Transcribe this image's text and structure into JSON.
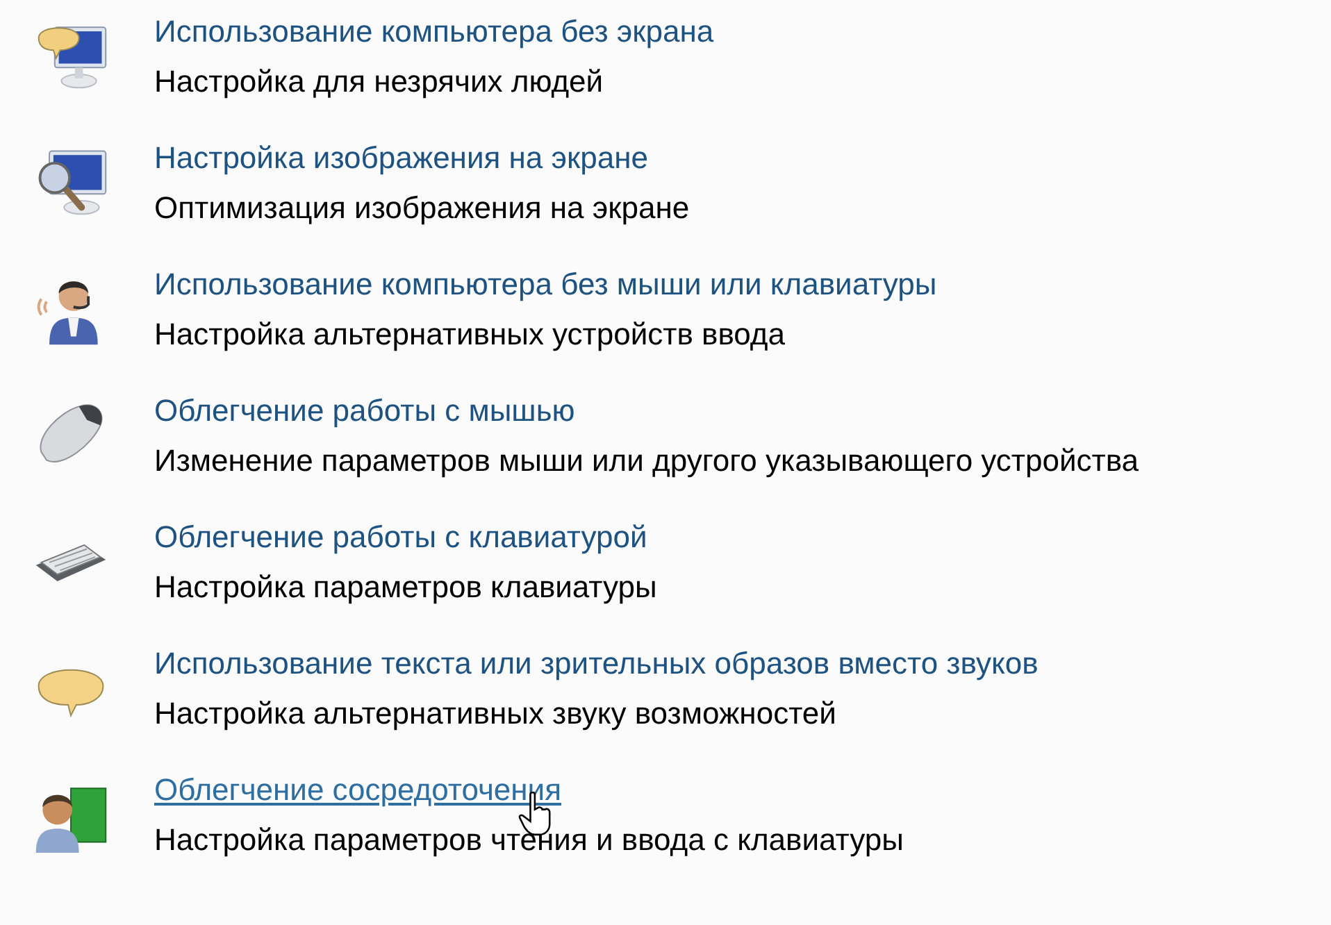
{
  "items": [
    {
      "title": "Использование компьютера без экрана",
      "description": "Настройка для незрячих людей",
      "hovered": false
    },
    {
      "title": "Настройка изображения на экране",
      "description": "Оптимизация изображения на экране",
      "hovered": false
    },
    {
      "title": "Использование компьютера без мыши или клавиатуры",
      "description": "Настройка альтернативных устройств ввода",
      "hovered": false
    },
    {
      "title": "Облегчение работы с мышью",
      "description": "Изменение параметров мыши или другого указывающего устройства",
      "hovered": false
    },
    {
      "title": "Облегчение работы с клавиатурой",
      "description": "Настройка параметров клавиатуры",
      "hovered": false
    },
    {
      "title": "Использование текста или зрительных образов вместо звуков",
      "description": "Настройка альтернативных звуку возможностей",
      "hovered": false
    },
    {
      "title": "Облегчение сосредоточения",
      "description": "Настройка параметров чтения и ввода с клавиатуры",
      "hovered": true
    }
  ]
}
